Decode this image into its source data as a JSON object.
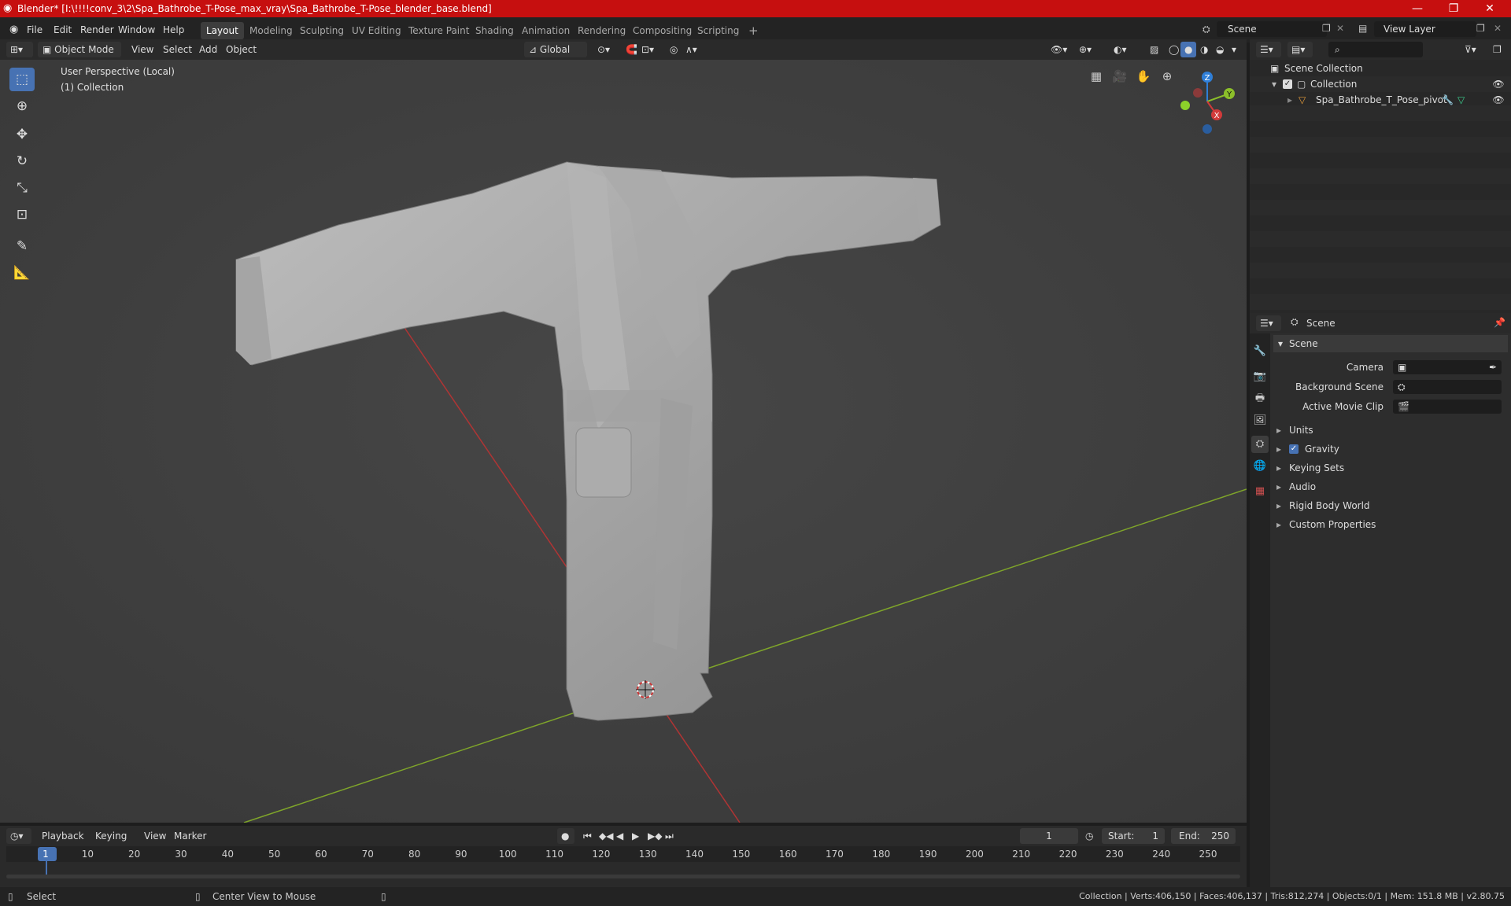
{
  "window": {
    "title": "Blender* [I:\\!!!!conv_3\\2\\Spa_Bathrobe_T-Pose_max_vray\\Spa_Bathrobe_T-Pose_blender_base.blend]",
    "minimize": "—",
    "maximize": "❐",
    "close": "✕"
  },
  "menu": [
    "File",
    "Edit",
    "Render",
    "Window",
    "Help"
  ],
  "workspaces": [
    "Layout",
    "Modeling",
    "Sculpting",
    "UV Editing",
    "Texture Paint",
    "Shading",
    "Animation",
    "Rendering",
    "Compositing",
    "Scripting"
  ],
  "workspace_add": "+",
  "scene_field": "Scene",
  "view_layer_field": "View Layer",
  "viewport_header": {
    "mode": "Object Mode",
    "menus": [
      "View",
      "Select",
      "Add",
      "Object"
    ],
    "transform_orientation": "Global"
  },
  "viewport": {
    "perspective_label": "User Perspective (Local)",
    "collection_label": "(1) Collection",
    "gizmo": {
      "z": "Z",
      "y": "Y",
      "x": "X"
    }
  },
  "outliner": {
    "root": "Scene Collection",
    "collection": "Collection",
    "object": "Spa_Bathrobe_T_Pose_pivot"
  },
  "properties": {
    "header": "Scene",
    "panel_title": "Scene",
    "camera_label": "Camera",
    "background_scene_label": "Background Scene",
    "active_movie_clip_label": "Active Movie Clip",
    "sections": [
      "Units",
      "Gravity",
      "Keying Sets",
      "Audio",
      "Rigid Body World",
      "Custom Properties"
    ],
    "gravity_checked": true
  },
  "timeline": {
    "menus": [
      "Playback",
      "Keying",
      "View",
      "Marker"
    ],
    "current_frame": "1",
    "start_label": "Start:",
    "start_value": "1",
    "end_label": "End:",
    "end_value": "250",
    "ruler": [
      "1",
      "10",
      "20",
      "30",
      "40",
      "50",
      "60",
      "70",
      "80",
      "90",
      "100",
      "110",
      "120",
      "130",
      "140",
      "150",
      "160",
      "170",
      "180",
      "190",
      "200",
      "210",
      "220",
      "230",
      "240",
      "250"
    ]
  },
  "status": {
    "left_action": "Select",
    "middle_action": "Center View to Mouse",
    "stats": "Collection | Verts:406,150 | Faces:406,137 | Tris:812,274 | Objects:0/1 | Mem: 151.8 MB | v2.80.75"
  },
  "colors": {
    "titlebar": "#c60f0f",
    "accent": "#4772b3",
    "x_axis": "#d23a3a",
    "y_axis": "#8cbf2a",
    "z_axis": "#2f7fd8"
  }
}
